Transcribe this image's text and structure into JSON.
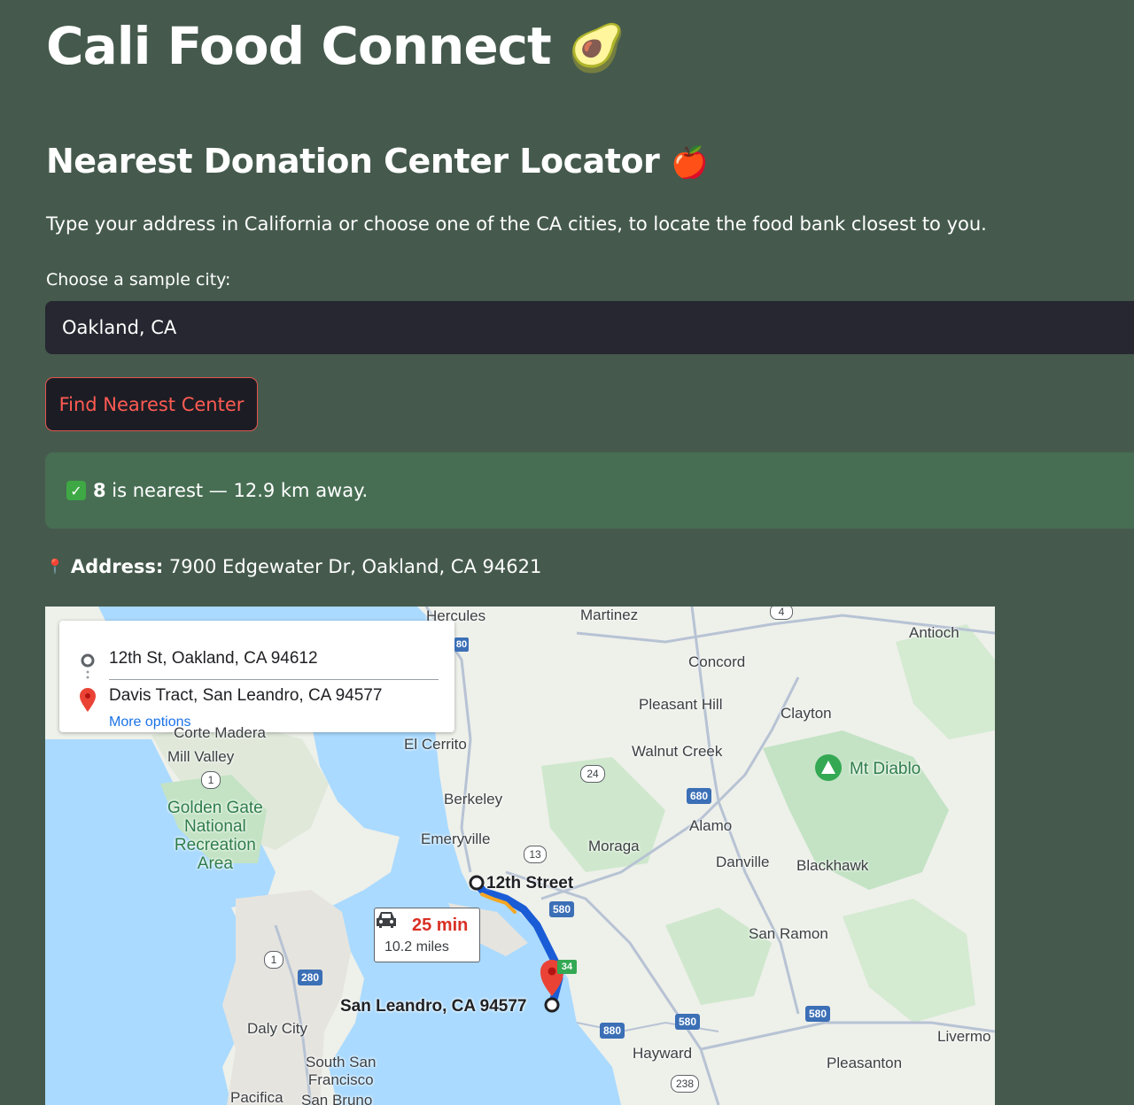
{
  "app": {
    "title": "Cali Food Connect",
    "title_emoji": "🥑",
    "subtitle": "Nearest Donation Center Locator",
    "subtitle_emoji": "🍎",
    "description": "Type your address in California or choose one of the CA cities, to locate the food bank closest to you."
  },
  "city_select": {
    "label": "Choose a sample city:",
    "value": "Oakland, CA"
  },
  "find_button": {
    "label": "Find Nearest Center"
  },
  "result": {
    "check_glyph": "✓",
    "center_id": "8",
    "message": " is nearest — 12.9 km away."
  },
  "address": {
    "pin_glyph": "📍",
    "label": "Address:",
    "value": " 7900 Edgewater Dr, Oakland, CA 94621"
  },
  "map": {
    "directions": {
      "origin": "12th St, Oakland, CA 94612",
      "destination": "Davis Tract, San Leandro, CA 94577",
      "more_options": "More options"
    },
    "route": {
      "time": "25 min",
      "distance": "10.2 miles"
    },
    "labels": {
      "hercules": "Hercules",
      "martinez": "Martinez",
      "antioch": "Antioch",
      "concord": "Concord",
      "pleasant_hill": "Pleasant Hill",
      "clayton": "Clayton",
      "walnut_creek": "Walnut Creek",
      "mt_diablo": "Mt Diablo",
      "el_cerrito": "El Cerrito",
      "corte_madera": "Corte Madera",
      "mill_valley": "Mill Valley",
      "golden_gate": "Golden Gate\nNational\nRecreation\nArea",
      "berkeley": "Berkeley",
      "emeryville": "Emeryville",
      "moraga": "Moraga",
      "alamo": "Alamo",
      "danville": "Danville",
      "blackhawk": "Blackhawk",
      "twelfth_street": "12th Street",
      "san_ramon": "San Ramon",
      "san_leandro": "San Leandro, CA 94577",
      "daly_city": "Daly City",
      "south_sf": "South San\nFrancisco",
      "hayward": "Hayward",
      "pleasanton": "Pleasanton",
      "livermore": "Livermo",
      "pacifica": "Pacifica",
      "san_bruno": "San Bruno"
    },
    "shields": {
      "i680a": "680",
      "i580a": "580",
      "r24": "24",
      "r13": "13",
      "r4": "4",
      "r1a": "1",
      "r1b": "1",
      "i280": "280",
      "i880": "880",
      "i580b": "580",
      "i580c": "580",
      "r238": "238",
      "i80": "80",
      "r34": "34"
    }
  }
}
